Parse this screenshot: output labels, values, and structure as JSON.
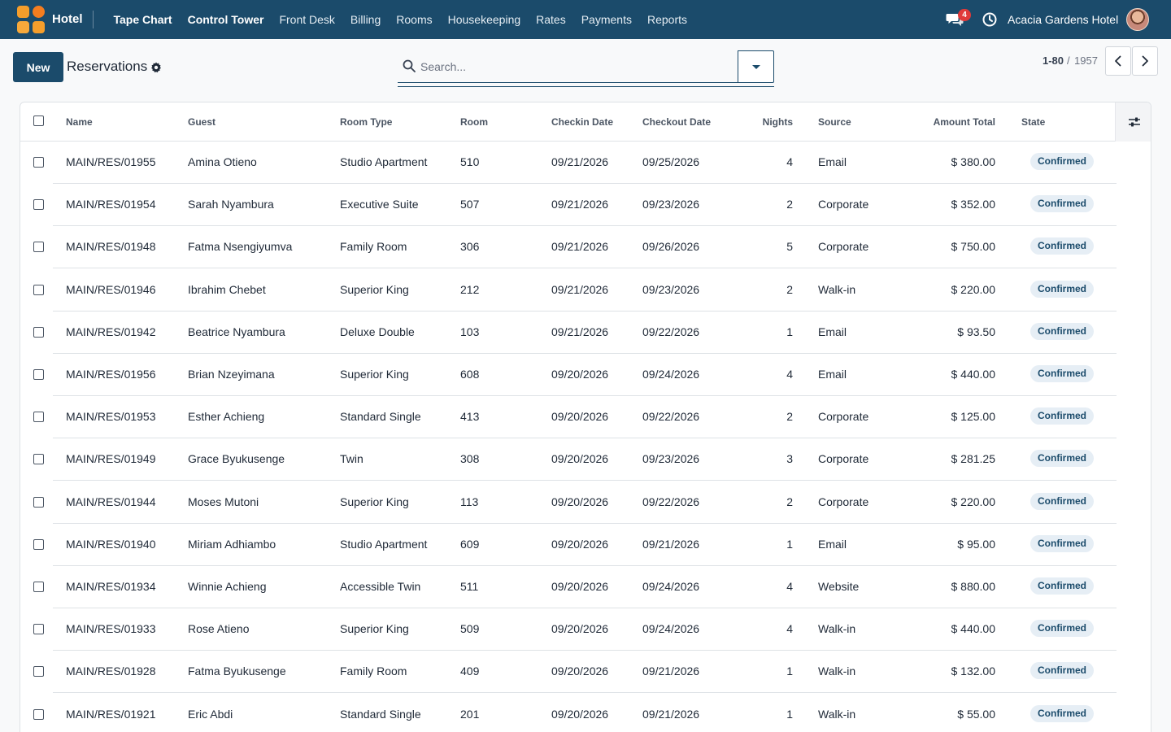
{
  "navbar": {
    "app_name": "Hotel",
    "menu": [
      "Tape Chart",
      "Control Tower",
      "Front Desk",
      "Billing",
      "Rooms",
      "Housekeeping",
      "Rates",
      "Payments",
      "Reports"
    ],
    "chat_badge": "4",
    "company": "Acacia Gardens Hotel",
    "colors": {
      "bar": "#1b4b6b",
      "badge": "#e03a3a"
    }
  },
  "control": {
    "new_label": "New",
    "breadcrumb": "Reservations",
    "search_placeholder": "Search...",
    "pager_value": "1-80",
    "pager_sep": "/",
    "pager_total": "1957"
  },
  "table": {
    "headers": {
      "name": "Name",
      "guest": "Guest",
      "room_type": "Room Type",
      "room": "Room",
      "checkin": "Checkin Date",
      "checkout": "Checkout Date",
      "nights": "Nights",
      "source": "Source",
      "amount": "Amount Total",
      "state": "State"
    },
    "rows": [
      {
        "name": "MAIN/RES/01955",
        "guest": "Amina Otieno",
        "room_type": "Studio Apartment",
        "room": "510",
        "checkin": "09/21/2026",
        "checkout": "09/25/2026",
        "nights": "4",
        "source": "Email",
        "amount": "$ 380.00",
        "state": "Confirmed"
      },
      {
        "name": "MAIN/RES/01954",
        "guest": "Sarah Nyambura",
        "room_type": "Executive Suite",
        "room": "507",
        "checkin": "09/21/2026",
        "checkout": "09/23/2026",
        "nights": "2",
        "source": "Corporate",
        "amount": "$ 352.00",
        "state": "Confirmed"
      },
      {
        "name": "MAIN/RES/01948",
        "guest": "Fatma Nsengiyumva",
        "room_type": "Family Room",
        "room": "306",
        "checkin": "09/21/2026",
        "checkout": "09/26/2026",
        "nights": "5",
        "source": "Corporate",
        "amount": "$ 750.00",
        "state": "Confirmed"
      },
      {
        "name": "MAIN/RES/01946",
        "guest": "Ibrahim Chebet",
        "room_type": "Superior King",
        "room": "212",
        "checkin": "09/21/2026",
        "checkout": "09/23/2026",
        "nights": "2",
        "source": "Walk-in",
        "amount": "$ 220.00",
        "state": "Confirmed"
      },
      {
        "name": "MAIN/RES/01942",
        "guest": "Beatrice Nyambura",
        "room_type": "Deluxe Double",
        "room": "103",
        "checkin": "09/21/2026",
        "checkout": "09/22/2026",
        "nights": "1",
        "source": "Email",
        "amount": "$ 93.50",
        "state": "Confirmed"
      },
      {
        "name": "MAIN/RES/01956",
        "guest": "Brian Nzeyimana",
        "room_type": "Superior King",
        "room": "608",
        "checkin": "09/20/2026",
        "checkout": "09/24/2026",
        "nights": "4",
        "source": "Email",
        "amount": "$ 440.00",
        "state": "Confirmed"
      },
      {
        "name": "MAIN/RES/01953",
        "guest": "Esther Achieng",
        "room_type": "Standard Single",
        "room": "413",
        "checkin": "09/20/2026",
        "checkout": "09/22/2026",
        "nights": "2",
        "source": "Corporate",
        "amount": "$ 125.00",
        "state": "Confirmed"
      },
      {
        "name": "MAIN/RES/01949",
        "guest": "Grace Byukusenge",
        "room_type": "Twin",
        "room": "308",
        "checkin": "09/20/2026",
        "checkout": "09/23/2026",
        "nights": "3",
        "source": "Corporate",
        "amount": "$ 281.25",
        "state": "Confirmed"
      },
      {
        "name": "MAIN/RES/01944",
        "guest": "Moses Mutoni",
        "room_type": "Superior King",
        "room": "113",
        "checkin": "09/20/2026",
        "checkout": "09/22/2026",
        "nights": "2",
        "source": "Corporate",
        "amount": "$ 220.00",
        "state": "Confirmed"
      },
      {
        "name": "MAIN/RES/01940",
        "guest": "Miriam Adhiambo",
        "room_type": "Studio Apartment",
        "room": "609",
        "checkin": "09/20/2026",
        "checkout": "09/21/2026",
        "nights": "1",
        "source": "Email",
        "amount": "$ 95.00",
        "state": "Confirmed"
      },
      {
        "name": "MAIN/RES/01934",
        "guest": "Winnie Achieng",
        "room_type": "Accessible Twin",
        "room": "511",
        "checkin": "09/20/2026",
        "checkout": "09/24/2026",
        "nights": "4",
        "source": "Website",
        "amount": "$ 880.00",
        "state": "Confirmed"
      },
      {
        "name": "MAIN/RES/01933",
        "guest": "Rose Atieno",
        "room_type": "Superior King",
        "room": "509",
        "checkin": "09/20/2026",
        "checkout": "09/24/2026",
        "nights": "4",
        "source": "Walk-in",
        "amount": "$ 440.00",
        "state": "Confirmed"
      },
      {
        "name": "MAIN/RES/01928",
        "guest": "Fatma Byukusenge",
        "room_type": "Family Room",
        "room": "409",
        "checkin": "09/20/2026",
        "checkout": "09/21/2026",
        "nights": "1",
        "source": "Walk-in",
        "amount": "$ 132.00",
        "state": "Confirmed"
      },
      {
        "name": "MAIN/RES/01921",
        "guest": "Eric Abdi",
        "room_type": "Standard Single",
        "room": "201",
        "checkin": "09/20/2026",
        "checkout": "09/21/2026",
        "nights": "1",
        "source": "Walk-in",
        "amount": "$ 55.00",
        "state": "Confirmed"
      }
    ]
  }
}
